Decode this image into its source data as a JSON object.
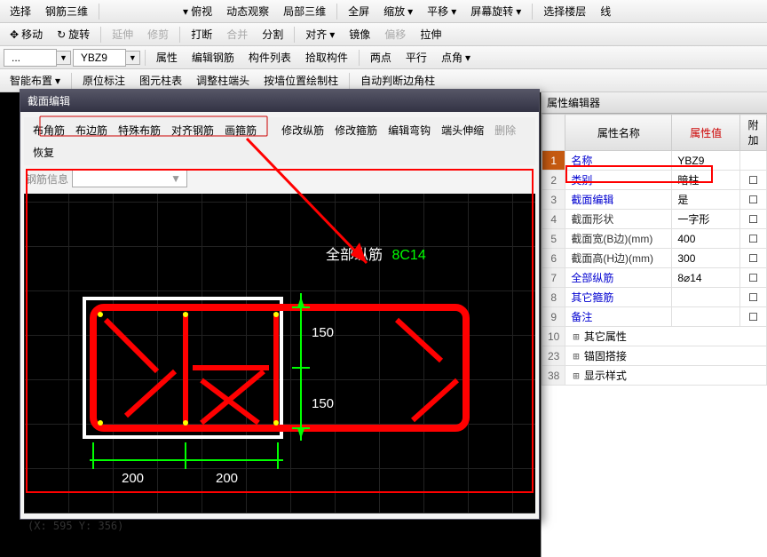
{
  "toolbar1": {
    "select": "选择",
    "rebar3d": "钢筋三维",
    "move": "移动",
    "rotate": "旋转",
    "extend": "延伸",
    "trim": "修剪",
    "break": "打断",
    "merge": "合并",
    "split": "分割",
    "align": "对齐",
    "mirror": "镜像",
    "offset": "偏移",
    "stretch": "拉伸",
    "part3d": "局部三维",
    "dynview": "动态观察",
    "overview": "俯视",
    "fullscreen": "全屏",
    "zoom": "缩放",
    "pan": "平移",
    "screenrot": "屏幕旋转",
    "sellayer": "选择楼层",
    "line": "线"
  },
  "toolbar2": {
    "dropdown1": "...",
    "dropdown2": "YBZ9",
    "attr": "属性",
    "editrebar": "编辑钢筋",
    "complist": "构件列表",
    "pickcomp": "拾取构件",
    "twopoint": "两点",
    "parallel": "平行",
    "pointangle": "点角",
    "smartlayout": "智能布置",
    "originmark": "原位标注",
    "figcol": "图元柱表",
    "adjustend": "调整柱端头",
    "drawbypos": "按墙位置绘制柱",
    "autocorner": "自动判断边角柱"
  },
  "prop": {
    "panel_title": "属性编辑器",
    "header_name": "属性名称",
    "header_value": "属性值",
    "header_extra": "附加",
    "rows": [
      {
        "n": "1",
        "name": "名称",
        "val": "YBZ9"
      },
      {
        "n": "2",
        "name": "类别",
        "val": "暗柱"
      },
      {
        "n": "3",
        "name": "截面编辑",
        "val": "是"
      },
      {
        "n": "4",
        "name": "截面形状",
        "val": "一字形"
      },
      {
        "n": "5",
        "name": "截面宽(B边)(mm)",
        "val": "400"
      },
      {
        "n": "6",
        "name": "截面高(H边)(mm)",
        "val": "300"
      },
      {
        "n": "7",
        "name": "全部纵筋",
        "val": "8⌀14"
      },
      {
        "n": "8",
        "name": "其它箍筋",
        "val": ""
      },
      {
        "n": "9",
        "name": "备注",
        "val": ""
      }
    ],
    "groups": [
      {
        "n": "10",
        "name": "其它属性"
      },
      {
        "n": "23",
        "name": "锚固搭接"
      },
      {
        "n": "38",
        "name": "显示样式"
      }
    ]
  },
  "dlg": {
    "title": "截面编辑",
    "tabs": [
      "布角筋",
      "布边筋",
      "特殊布筋",
      "对齐钢筋",
      "画箍筋"
    ],
    "actions": [
      "修改纵筋",
      "修改箍筋",
      "编辑弯钩",
      "端头伸缩",
      "删除",
      "恢复"
    ],
    "rebarinfo_label": "钢筋信息",
    "rebarinfo_placeholder": "",
    "status": "(X: 595 Y: 356)"
  },
  "drawing": {
    "label_text": "全部纵筋",
    "label_code": "8C14",
    "dim_h1": "200",
    "dim_h2": "200",
    "dim_v1": "150",
    "dim_v2": "150"
  }
}
